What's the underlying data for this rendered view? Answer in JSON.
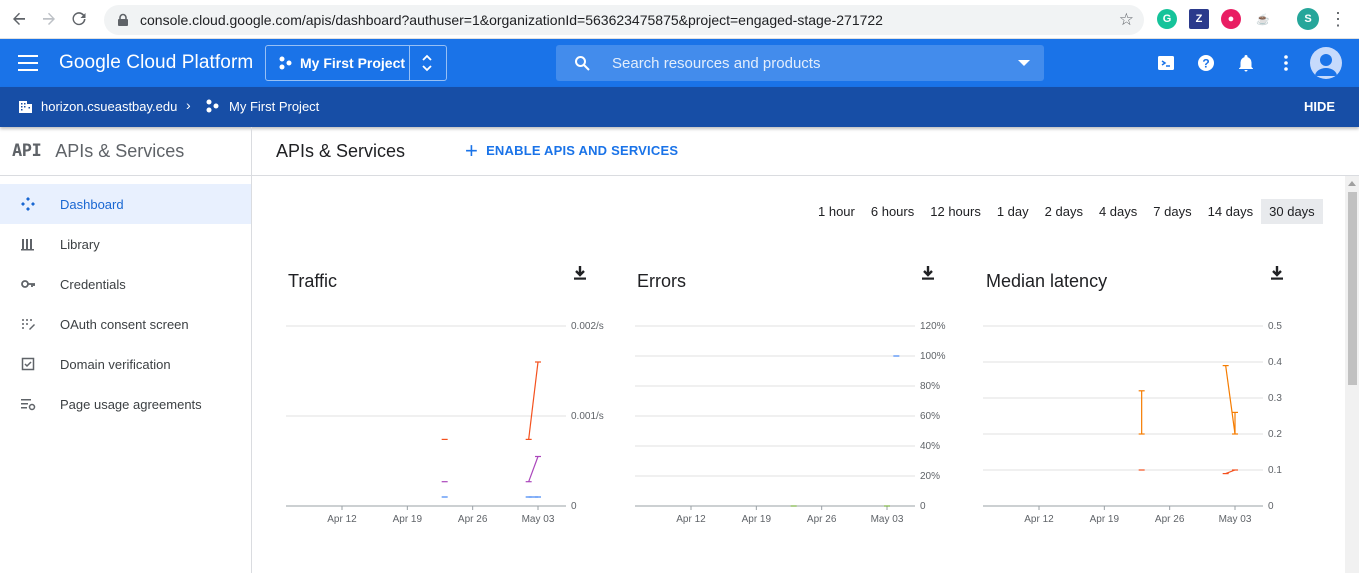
{
  "browser": {
    "url": "console.cloud.google.com/apis/dashboard?authuser=1&organizationId=563623475875&project=engaged-stage-271722",
    "profile_initial": "S"
  },
  "header": {
    "brand": "Google Cloud Platform",
    "project_label": "My First Project",
    "search_placeholder": "Search resources and products"
  },
  "orgbar": {
    "org": "horizon.csueastbay.edu",
    "project": "My First Project",
    "hide_label": "HIDE"
  },
  "sidebar": {
    "logo": "API",
    "title": "APIs & Services",
    "items": [
      {
        "label": "Dashboard",
        "icon": "dashboard-icon"
      },
      {
        "label": "Library",
        "icon": "library-icon"
      },
      {
        "label": "Credentials",
        "icon": "key-icon"
      },
      {
        "label": "OAuth consent screen",
        "icon": "oauth-icon"
      },
      {
        "label": "Domain verification",
        "icon": "checkbox-icon"
      },
      {
        "label": "Page usage agreements",
        "icon": "settings-list-icon"
      }
    ]
  },
  "main": {
    "title": "APIs & Services",
    "enable_label": "ENABLE APIS AND SERVICES",
    "ranges": [
      "1 hour",
      "6 hours",
      "12 hours",
      "1 day",
      "2 days",
      "4 days",
      "7 days",
      "14 days",
      "30 days"
    ],
    "selected_range": "30 days"
  },
  "colors": {
    "primary": "#1a73e8",
    "org_bar": "#174ea6",
    "series_orange": "#f4511e",
    "series_purple": "#ab47bc",
    "series_blue": "#4285f4",
    "series_green": "#7cb342",
    "series_amber": "#f57c00"
  },
  "chart_data": [
    {
      "type": "line",
      "title": "Traffic",
      "x": [
        "Apr 12",
        "Apr 19",
        "Apr 26",
        "May 03"
      ],
      "y_ticks": [
        "0.002/s",
        "0.001/s",
        "0"
      ],
      "ylim": [
        0,
        0.002
      ],
      "series": [
        {
          "values": [
            {
              "x": "Apr 23",
              "y": 0.00074
            },
            {
              "x": "May 02",
              "y": 0.00074
            },
            {
              "x": "May 03",
              "y": 0.0016
            }
          ]
        },
        {
          "values": [
            {
              "x": "Apr 23",
              "y": 0.00027
            },
            {
              "x": "May 02",
              "y": 0.00027
            },
            {
              "x": "May 03",
              "y": 0.00055
            }
          ]
        },
        {
          "values": [
            {
              "x": "Apr 23",
              "y": 0.0001
            },
            {
              "x": "May 02",
              "y": 0.0001
            },
            {
              "x": "May 03",
              "y": 0.0001
            }
          ]
        }
      ]
    },
    {
      "type": "line",
      "title": "Errors",
      "x": [
        "Apr 12",
        "Apr 19",
        "Apr 26",
        "May 03"
      ],
      "y_ticks": [
        "120%",
        "100%",
        "80%",
        "60%",
        "40%",
        "20%",
        "0"
      ],
      "ylim": [
        0,
        120
      ],
      "series": [
        {
          "values": [
            {
              "x": "May 04",
              "y": 100
            }
          ]
        },
        {
          "values": [
            {
              "x": "Apr 23",
              "y": 0
            },
            {
              "x": "May 03",
              "y": 0
            }
          ]
        }
      ]
    },
    {
      "type": "line",
      "title": "Median latency",
      "x": [
        "Apr 12",
        "Apr 19",
        "Apr 26",
        "May 03"
      ],
      "y_ticks": [
        "0.5",
        "0.4",
        "0.3",
        "0.2",
        "0.1",
        "0"
      ],
      "ylim": [
        0,
        0.5
      ],
      "series": [
        {
          "values": [
            {
              "x": "Apr 23",
              "y": 0.2
            },
            {
              "x": "Apr 23",
              "y": 0.32
            },
            {
              "x": "May 02",
              "y": 0.39
            },
            {
              "x": "May 03",
              "y": 0.2
            },
            {
              "x": "May 03",
              "y": 0.26
            }
          ]
        },
        {
          "values": [
            {
              "x": "Apr 23",
              "y": 0.1
            },
            {
              "x": "May 02",
              "y": 0.09
            },
            {
              "x": "May 03",
              "y": 0.1
            }
          ]
        }
      ]
    }
  ]
}
